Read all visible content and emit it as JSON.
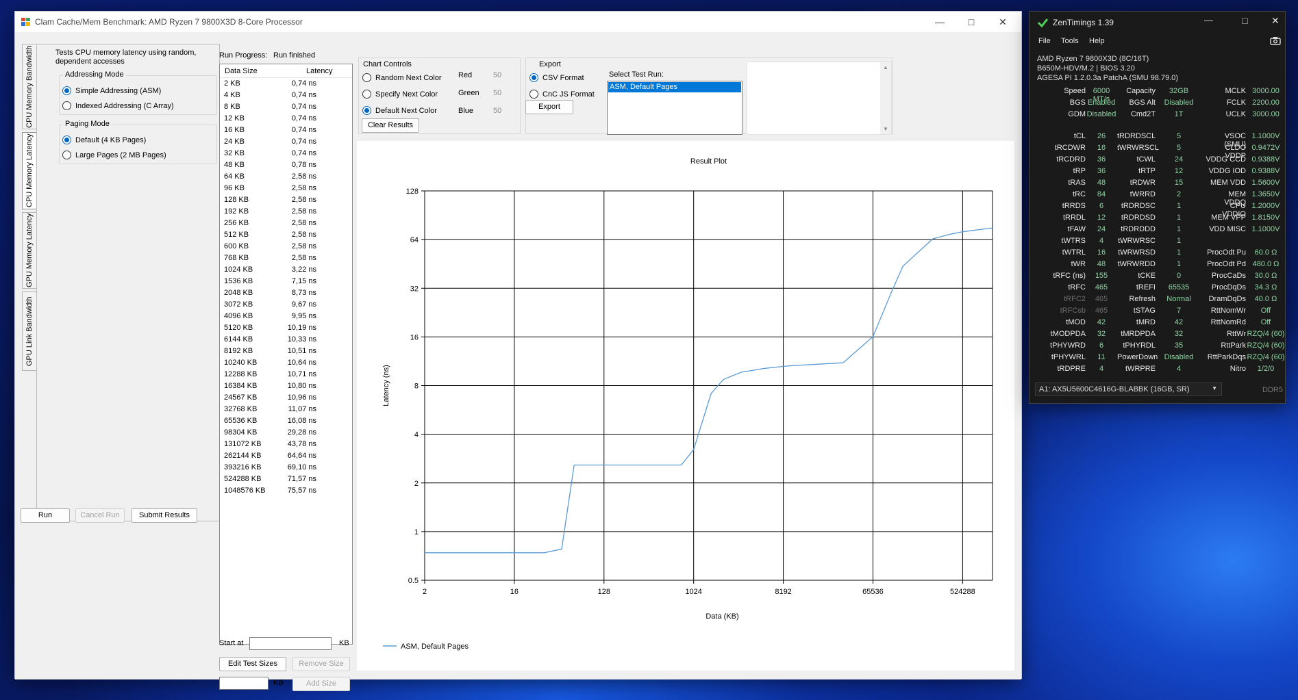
{
  "bench": {
    "title": "Clam Cache/Mem Benchmark: AMD Ryzen 7 9800X3D 8-Core Processor",
    "tabs": [
      "CPU Memory Bandwidth",
      "CPU Memory Latency",
      "GPU Memory Latency",
      "GPU Link Bandwidth"
    ],
    "selected_tab": "CPU Memory Latency",
    "description": "Tests CPU memory latency using random, dependent accesses",
    "addressing_mode": {
      "title": "Addressing Mode",
      "options": [
        "Simple Addressing (ASM)",
        "Indexed Addressing (C Array)"
      ],
      "selected": "Simple Addressing (ASM)"
    },
    "paging_mode": {
      "title": "Paging Mode",
      "options": [
        "Default (4 KB Pages)",
        "Large Pages (2 MB Pages)"
      ],
      "selected": "Default (4 KB Pages)"
    },
    "buttons": {
      "run": "Run",
      "cancel": "Cancel Run",
      "submit": "Submit Results"
    },
    "progress": {
      "label": "Run Progress:",
      "value": "Run finished"
    },
    "results_table": {
      "headers": [
        "Data Size",
        "Latency"
      ],
      "rows": [
        [
          "2 KB",
          "0,74 ns"
        ],
        [
          "4 KB",
          "0,74 ns"
        ],
        [
          "8 KB",
          "0,74 ns"
        ],
        [
          "12 KB",
          "0,74 ns"
        ],
        [
          "16 KB",
          "0,74 ns"
        ],
        [
          "24 KB",
          "0,74 ns"
        ],
        [
          "32 KB",
          "0,74 ns"
        ],
        [
          "48 KB",
          "0,78 ns"
        ],
        [
          "64 KB",
          "2,58 ns"
        ],
        [
          "96 KB",
          "2,58 ns"
        ],
        [
          "128 KB",
          "2,58 ns"
        ],
        [
          "192 KB",
          "2,58 ns"
        ],
        [
          "256 KB",
          "2,58 ns"
        ],
        [
          "512 KB",
          "2,58 ns"
        ],
        [
          "600 KB",
          "2,58 ns"
        ],
        [
          "768 KB",
          "2,58 ns"
        ],
        [
          "1024 KB",
          "3,22 ns"
        ],
        [
          "1536 KB",
          "7,15 ns"
        ],
        [
          "2048 KB",
          "8,73 ns"
        ],
        [
          "3072 KB",
          "9,67 ns"
        ],
        [
          "4096 KB",
          "9,95 ns"
        ],
        [
          "5120 KB",
          "10,19 ns"
        ],
        [
          "6144 KB",
          "10,33 ns"
        ],
        [
          "8192 KB",
          "10,51 ns"
        ],
        [
          "10240 KB",
          "10,64 ns"
        ],
        [
          "12288 KB",
          "10,71 ns"
        ],
        [
          "16384 KB",
          "10,80 ns"
        ],
        [
          "24567 KB",
          "10,96 ns"
        ],
        [
          "32768 KB",
          "11,07 ns"
        ],
        [
          "65536 KB",
          "16,08 ns"
        ],
        [
          "98304 KB",
          "29,28 ns"
        ],
        [
          "131072 KB",
          "43,78 ns"
        ],
        [
          "262144 KB",
          "64,64 ns"
        ],
        [
          "393216 KB",
          "69,10 ns"
        ],
        [
          "524288 KB",
          "71,57 ns"
        ],
        [
          "1048576 KB",
          "75,57 ns"
        ]
      ]
    },
    "start_at": {
      "label": "Start at",
      "unit": "KB"
    },
    "size_buttons": {
      "edit": "Edit Test Sizes",
      "remove": "Remove Size",
      "add": "Add Size",
      "unit": "KB"
    },
    "chart_controls": {
      "title": "Chart Controls",
      "options": [
        "Random Next Color",
        "Specify Next Color",
        "Default Next Color"
      ],
      "selected": "Default Next Color",
      "rgb": [
        {
          "label": "Red",
          "value": "50"
        },
        {
          "label": "Green",
          "value": "50"
        },
        {
          "label": "Blue",
          "value": "50"
        }
      ],
      "clear": "Clear Results"
    },
    "export": {
      "title": "Export",
      "options": [
        "CSV Format",
        "CnC JS Format"
      ],
      "selected": "CSV Format",
      "button": "Export",
      "select_label": "Select Test Run:",
      "runs": [
        "ASM, Default Pages"
      ]
    }
  },
  "chart_data": {
    "type": "line",
    "title": "Result Plot",
    "xlabel": "Data (KB)",
    "ylabel": "Latency (ns)",
    "x_scale": "log2",
    "y_scale": "log2",
    "xlim": [
      2,
      1048576
    ],
    "ylim": [
      0.5,
      128
    ],
    "x_ticks": [
      2,
      16,
      128,
      1024,
      8192,
      65536,
      524288
    ],
    "y_ticks": [
      0.5,
      1,
      2,
      4,
      8,
      16,
      32,
      64,
      128
    ],
    "grid": true,
    "legend_position": "bottom-left",
    "series": [
      {
        "name": "ASM, Default Pages",
        "color": "#5b9bd5",
        "x": [
          2,
          4,
          8,
          12,
          16,
          24,
          32,
          48,
          64,
          96,
          128,
          192,
          256,
          512,
          600,
          768,
          1024,
          1536,
          2048,
          3072,
          4096,
          5120,
          6144,
          8192,
          10240,
          12288,
          16384,
          24567,
          32768,
          65536,
          98304,
          131072,
          262144,
          393216,
          524288,
          1048576
        ],
        "y": [
          0.74,
          0.74,
          0.74,
          0.74,
          0.74,
          0.74,
          0.74,
          0.78,
          2.58,
          2.58,
          2.58,
          2.58,
          2.58,
          2.58,
          2.58,
          2.58,
          3.22,
          7.15,
          8.73,
          9.67,
          9.95,
          10.19,
          10.33,
          10.51,
          10.64,
          10.71,
          10.8,
          10.96,
          11.07,
          16.08,
          29.28,
          43.78,
          64.64,
          69.1,
          71.57,
          75.57
        ]
      }
    ]
  },
  "zen": {
    "title": "ZenTimings 1.39",
    "menu": [
      "File",
      "Tools",
      "Help"
    ],
    "info": [
      "AMD Ryzen 7 9800X3D (8C/16T)",
      "B650M-HDV/M.2 | BIOS 3.20",
      "AGESA PI 1.2.0.3a PatchA (SMU 98.79.0)"
    ],
    "top_rows": [
      [
        [
          "Speed",
          "6000 MT/s"
        ],
        [
          "Capacity",
          "32GB"
        ],
        [
          "MCLK",
          "3000.00"
        ]
      ],
      [
        [
          "BGS",
          "Enabled"
        ],
        [
          "BGS Alt",
          "Disabled"
        ],
        [
          "FCLK",
          "2200.00"
        ]
      ],
      [
        [
          "GDM",
          "Disabled"
        ],
        [
          "Cmd2T",
          "1T"
        ],
        [
          "UCLK",
          "3000.00"
        ]
      ]
    ],
    "rows": [
      [
        [
          "tCL",
          "26"
        ],
        [
          "tRDRDSCL",
          "5"
        ],
        [
          "VSOC (SMU)",
          "1.1000V"
        ]
      ],
      [
        [
          "tRCDWR",
          "16"
        ],
        [
          "tWRWRSCL",
          "5"
        ],
        [
          "CLDO VDDP",
          "0.9472V"
        ]
      ],
      [
        [
          "tRCDRD",
          "36"
        ],
        [
          "tCWL",
          "24"
        ],
        [
          "VDDG CCD",
          "0.9388V"
        ]
      ],
      [
        [
          "tRP",
          "36"
        ],
        [
          "tRTP",
          "12"
        ],
        [
          "VDDG IOD",
          "0.9388V"
        ]
      ],
      [
        [
          "tRAS",
          "48"
        ],
        [
          "tRDWR",
          "15"
        ],
        [
          "MEM VDD",
          "1.5600V"
        ]
      ],
      [
        [
          "tRC",
          "84"
        ],
        [
          "tWRRD",
          "2"
        ],
        [
          "MEM VDDQ",
          "1.3650V"
        ]
      ],
      [
        [
          "tRRDS",
          "6"
        ],
        [
          "tRDRDSC",
          "1"
        ],
        [
          "CPU VDDIO",
          "1.2000V"
        ]
      ],
      [
        [
          "tRRDL",
          "12"
        ],
        [
          "tRDRDSD",
          "1"
        ],
        [
          "MEM VPP",
          "1.8150V"
        ]
      ],
      [
        [
          "tFAW",
          "24"
        ],
        [
          "tRDRDDD",
          "1"
        ],
        [
          "VDD MISC",
          "1.1000V"
        ]
      ],
      [
        [
          "tWTRS",
          "4"
        ],
        [
          "tWRWRSC",
          "1"
        ],
        [
          "",
          ""
        ]
      ],
      [
        [
          "tWTRL",
          "16"
        ],
        [
          "tWRWRSD",
          "1"
        ],
        [
          "ProcOdt Pu",
          "60.0 Ω"
        ]
      ],
      [
        [
          "tWR",
          "48"
        ],
        [
          "tWRWRDD",
          "1"
        ],
        [
          "ProcOdt Pd",
          "480.0 Ω"
        ]
      ],
      [
        [
          "tRFC (ns)",
          "155"
        ],
        [
          "tCKE",
          "0"
        ],
        [
          "ProcCaDs",
          "30.0 Ω"
        ]
      ],
      [
        [
          "tRFC",
          "465"
        ],
        [
          "tREFI",
          "65535"
        ],
        [
          "ProcDqDs",
          "34.3 Ω"
        ]
      ],
      [
        [
          "tRFC2",
          "465"
        ],
        [
          "Refresh",
          "Normal"
        ],
        [
          "DramDqDs",
          "40.0 Ω"
        ]
      ],
      [
        [
          "tRFCsb",
          "465"
        ],
        [
          "tSTAG",
          "7"
        ],
        [
          "RttNomWr",
          "Off"
        ]
      ],
      [
        [
          "tMOD",
          "42"
        ],
        [
          "tMRD",
          "42"
        ],
        [
          "RttNomRd",
          "Off"
        ]
      ],
      [
        [
          "tMODPDA",
          "32"
        ],
        [
          "tMRDPDA",
          "32"
        ],
        [
          "RttWr",
          "RZQ/4 (60)"
        ]
      ],
      [
        [
          "tPHYWRD",
          "6"
        ],
        [
          "tPHYRDL",
          "35"
        ],
        [
          "RttPark",
          "RZQ/4 (60)"
        ]
      ],
      [
        [
          "tPHYWRL",
          "11"
        ],
        [
          "PowerDown",
          "Disabled"
        ],
        [
          "RttParkDqs",
          "RZQ/4 (60)"
        ]
      ],
      [
        [
          "tRDPRE",
          "4"
        ],
        [
          "tWRPRE",
          "4"
        ],
        [
          "Nitro",
          "1/2/0"
        ]
      ]
    ],
    "module": "A1: AX5U5600C4616G-BLABBK (16GB, SR)",
    "mem_type": "DDR5",
    "colors": {
      "value": "#8fd4a4",
      "dim": "#6d6d6d",
      "accent": "#0067c0"
    }
  }
}
